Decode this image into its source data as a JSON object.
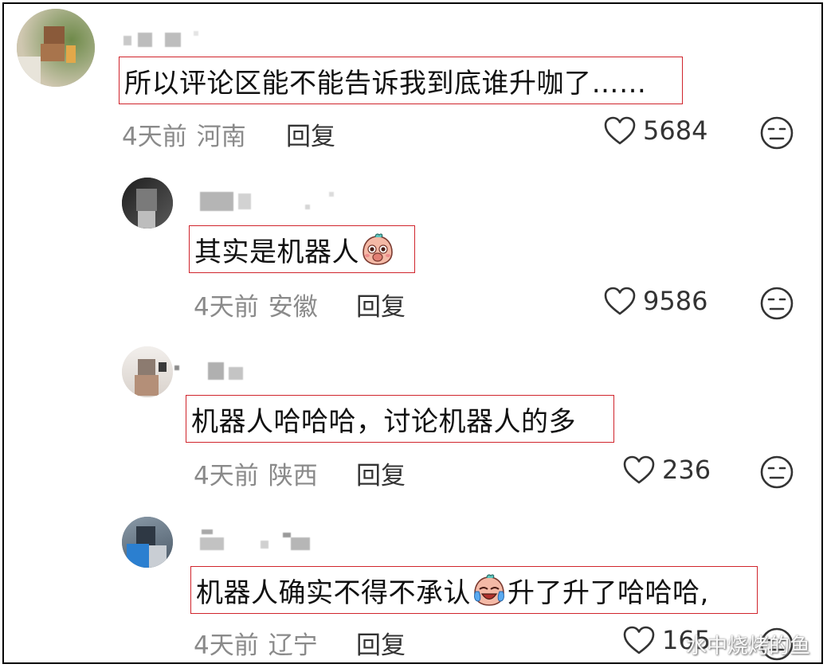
{
  "comments": [
    {
      "text": "所以评论区能不能告诉我到底谁升咖了……",
      "time": "4天前",
      "location": "河南",
      "reply_label": "回复",
      "likes": "5684"
    },
    {
      "text": "其实是机器人",
      "emoji": "shy-face-emoji",
      "time": "4天前",
      "location": "安徽",
      "reply_label": "回复",
      "likes": "9586"
    },
    {
      "text": "机器人哈哈哈，讨论机器人的多",
      "time": "4天前",
      "location": "陕西",
      "reply_label": "回复",
      "likes": "236"
    },
    {
      "text_before": "机器人确实不得不承认",
      "emoji": "crying-laughing-emoji",
      "text_after": "升了升了哈哈哈,",
      "time": "4天前",
      "location": "辽宁",
      "reply_label": "回复",
      "likes": "165"
    }
  ],
  "watermark": "水中烧烤的鱼",
  "colors": {
    "highlight_border": "#d0242c",
    "meta_text": "#8a8a8a",
    "primary_text": "#111111"
  }
}
